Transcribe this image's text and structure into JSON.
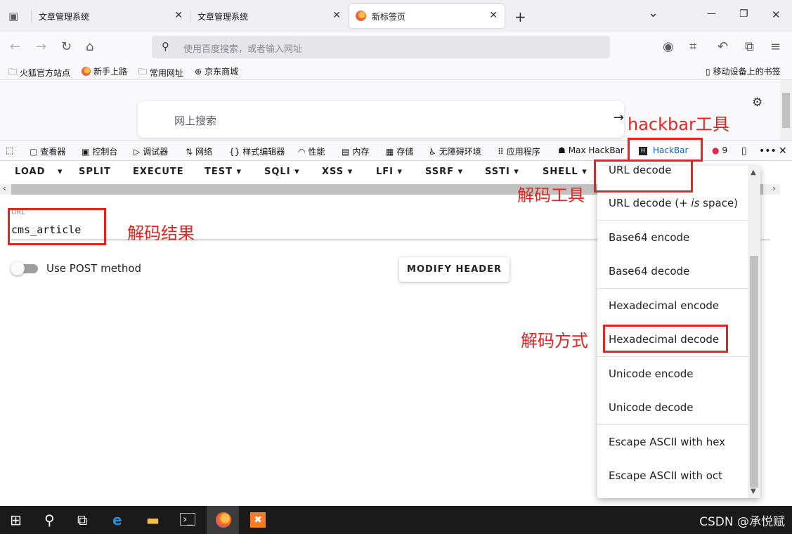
{
  "tabs": [
    {
      "title": "文章管理系统",
      "close": "✕"
    },
    {
      "title": "文章管理系统",
      "close": "✕"
    },
    {
      "title": "新标签页",
      "close": "✕"
    }
  ],
  "tabbar": {
    "new_tab": "+",
    "list": "⌄",
    "minimize": "—",
    "restore": "❐",
    "close": "✕"
  },
  "navbar": {
    "placeholder": "使用百度搜索，或者输入网址"
  },
  "bookmarks": {
    "items": [
      "火狐官方站点",
      "新手上路",
      "常用网址",
      "京东商城"
    ],
    "mobile": "移动设备上的书签"
  },
  "content": {
    "search_placeholder": "网上搜索",
    "arrow": "→"
  },
  "devtools": {
    "tabs": [
      "查看器",
      "控制台",
      "调试器",
      "网络",
      "样式编辑器",
      "性能",
      "内存",
      "存储",
      "无障碍环境",
      "应用程序",
      "Max HackBar",
      "HackBar"
    ],
    "error_count": "9"
  },
  "hackbar": {
    "menu": [
      "LOAD",
      "SPLIT",
      "EXECUTE",
      "TEST",
      "SQLI",
      "XSS",
      "LFI",
      "SSRF",
      "SSTI",
      "SHELL"
    ],
    "url_label": "URL",
    "url_value": "cms_article",
    "post_label": "Use POST method",
    "modify_header": "MODIFY HEADER"
  },
  "dropdown": {
    "items": [
      "URL decode",
      "URL decode (+ is space)",
      "Base64 encode",
      "Base64 decode",
      "Hexadecimal encode",
      "Hexadecimal decode",
      "Unicode encode",
      "Unicode decode",
      "Escape ASCII with hex",
      "Escape ASCII with oct"
    ],
    "item2_prefix": "URL decode (+ ",
    "item2_em": "is",
    "item2_suffix": " space)"
  },
  "annotations": {
    "hackbar_tool": "hackbar工具",
    "decode_tool": "解码工具",
    "decode_result": "解码结果",
    "decode_method": "解码方式"
  },
  "watermark": "CSDN @承悦赋",
  "colors": {
    "annotation": "#e8231e",
    "active_tab_underline": "#0061e0"
  }
}
